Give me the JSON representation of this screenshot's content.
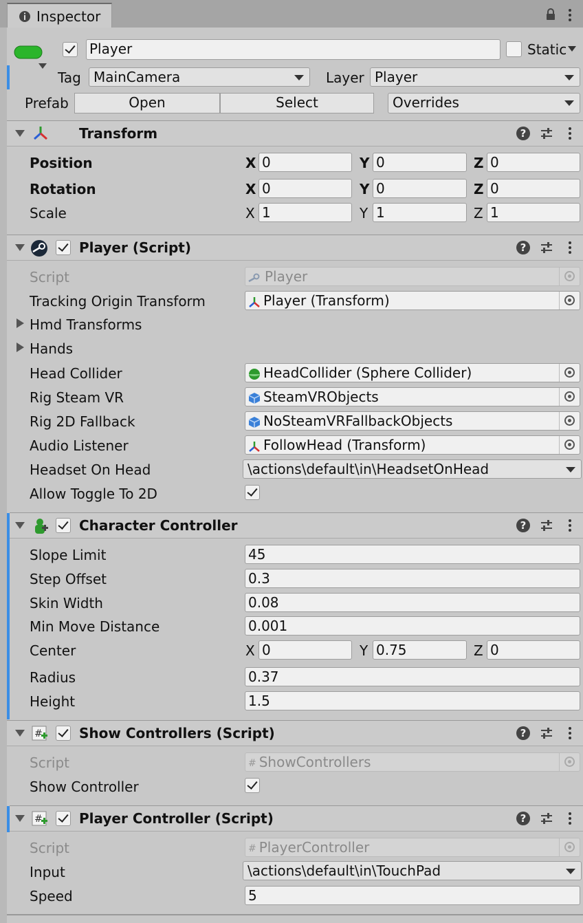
{
  "tab": {
    "title": "Inspector"
  },
  "object": {
    "name": "Player",
    "active": true,
    "static_label": "Static",
    "static": false,
    "tag_label": "Tag",
    "tag": "MainCamera",
    "layer_label": "Layer",
    "layer": "Player",
    "prefab_label": "Prefab",
    "open": "Open",
    "select": "Select",
    "overrides": "Overrides"
  },
  "transform": {
    "title": "Transform",
    "rows": [
      {
        "label": "Position",
        "x": "0",
        "y": "0",
        "z": "0"
      },
      {
        "label": "Rotation",
        "x": "0",
        "y": "0",
        "z": "0"
      },
      {
        "label": "Scale",
        "x": "1",
        "y": "1",
        "z": "1"
      }
    ]
  },
  "axes": {
    "x": "X",
    "y": "Y",
    "z": "Z"
  },
  "player": {
    "title": "Player (Script)",
    "enabled": true,
    "script_label": "Script",
    "script": "Player",
    "tracking_label": "Tracking Origin Transform",
    "tracking": "Player (Transform)",
    "hmd_label": "Hmd Transforms",
    "hands_label": "Hands",
    "head_label": "Head Collider",
    "head": "HeadCollider (Sphere Collider)",
    "rig_label": "Rig Steam VR",
    "rig": "SteamVRObjects",
    "rig2d_label": "Rig 2D Fallback",
    "rig2d": "NoSteamVRFallbackObjects",
    "audio_label": "Audio Listener",
    "audio": "FollowHead (Transform)",
    "headset_label": "Headset On Head",
    "headset": "\\actions\\default\\in\\HeadsetOnHead",
    "toggle_label": "Allow Toggle To 2D",
    "toggle": true
  },
  "cc": {
    "title": "Character Controller",
    "enabled": true,
    "slope_label": "Slope Limit",
    "slope": "45",
    "step_label": "Step Offset",
    "step": "0.3",
    "skin_label": "Skin Width",
    "skin": "0.08",
    "minmove_label": "Min Move Distance",
    "minmove": "0.001",
    "center_label": "Center",
    "cx": "0",
    "cy": "0.75",
    "cz": "0",
    "radius_label": "Radius",
    "radius": "0.37",
    "height_label": "Height",
    "height": "1.5"
  },
  "show": {
    "title": "Show Controllers (Script)",
    "enabled": true,
    "script_label": "Script",
    "script": "ShowControllers",
    "show_label": "Show Controller",
    "show": true
  },
  "pc": {
    "title": "Player Controller (Script)",
    "enabled": true,
    "script_label": "Script",
    "script": "PlayerController",
    "input_label": "Input",
    "input": "\\actions\\default\\in\\TouchPad",
    "speed_label": "Speed",
    "speed": "5"
  },
  "icons": [
    "info-icon",
    "lock-icon",
    "menu-kebab-icon",
    "transform-axes-icon",
    "steam-icon",
    "character-controller-icon",
    "script-hash-icon",
    "help-icon",
    "presets-sliders-icon",
    "object-picker-icon",
    "sphere-collider-icon",
    "prefab-cube-icon"
  ],
  "colors": {
    "selection": "#3a8ee6",
    "panel": "#c8c8c8",
    "field": "#f0f0f0",
    "header": "#cbcbcb"
  }
}
